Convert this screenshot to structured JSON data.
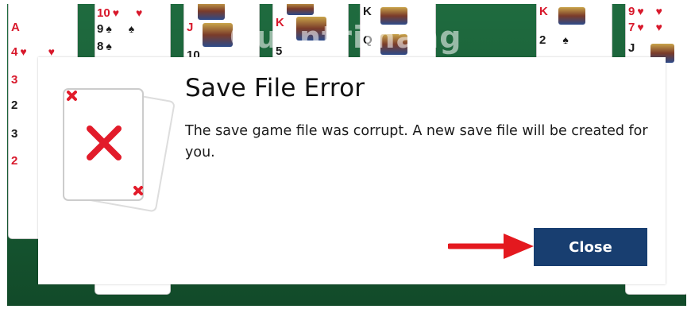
{
  "dialog": {
    "title": "Save File Error",
    "message": "The save game file was corrupt. A new save file will be created for you.",
    "close_label": "Close"
  },
  "board": {
    "cards": [
      {
        "rank": "A",
        "suit": "♥",
        "color": "red"
      },
      {
        "rank": "4",
        "suit": "♥",
        "color": "red"
      },
      {
        "rank": "3",
        "suit": "♥",
        "color": "red"
      },
      {
        "rank": "2",
        "suit": "♠",
        "color": "black"
      },
      {
        "rank": "3",
        "suit": "♠",
        "color": "black"
      },
      {
        "rank": "2",
        "suit": "♥",
        "color": "red"
      },
      {
        "rank": "10",
        "suit": "♥",
        "color": "red"
      },
      {
        "rank": "9",
        "suit": "♠",
        "color": "black"
      },
      {
        "rank": "8",
        "suit": "♠",
        "color": "black"
      },
      {
        "rank": "10",
        "suit": "",
        "color": "black"
      },
      {
        "rank": "J",
        "suit": "♥",
        "color": "red"
      },
      {
        "rank": "K",
        "suit": "♥",
        "color": "red"
      },
      {
        "rank": "5",
        "suit": "",
        "color": "black"
      },
      {
        "rank": "K",
        "suit": "♠",
        "color": "black"
      },
      {
        "rank": "Q",
        "suit": "♠",
        "color": "black"
      },
      {
        "rank": "K",
        "suit": "♥",
        "color": "red"
      },
      {
        "rank": "2",
        "suit": "♠",
        "color": "black"
      },
      {
        "rank": "9",
        "suit": "♥",
        "color": "red"
      },
      {
        "rank": "7",
        "suit": "♥",
        "color": "red"
      },
      {
        "rank": "J",
        "suit": "",
        "color": "black"
      }
    ]
  },
  "watermark": "Quantrimang",
  "icons": {
    "dialog_graphic": "error-cards-icon",
    "pointer": "red-arrow-icon"
  },
  "colors": {
    "button": "#183e70",
    "error_red": "#e21b2a",
    "felt": "#1f6b3f"
  }
}
